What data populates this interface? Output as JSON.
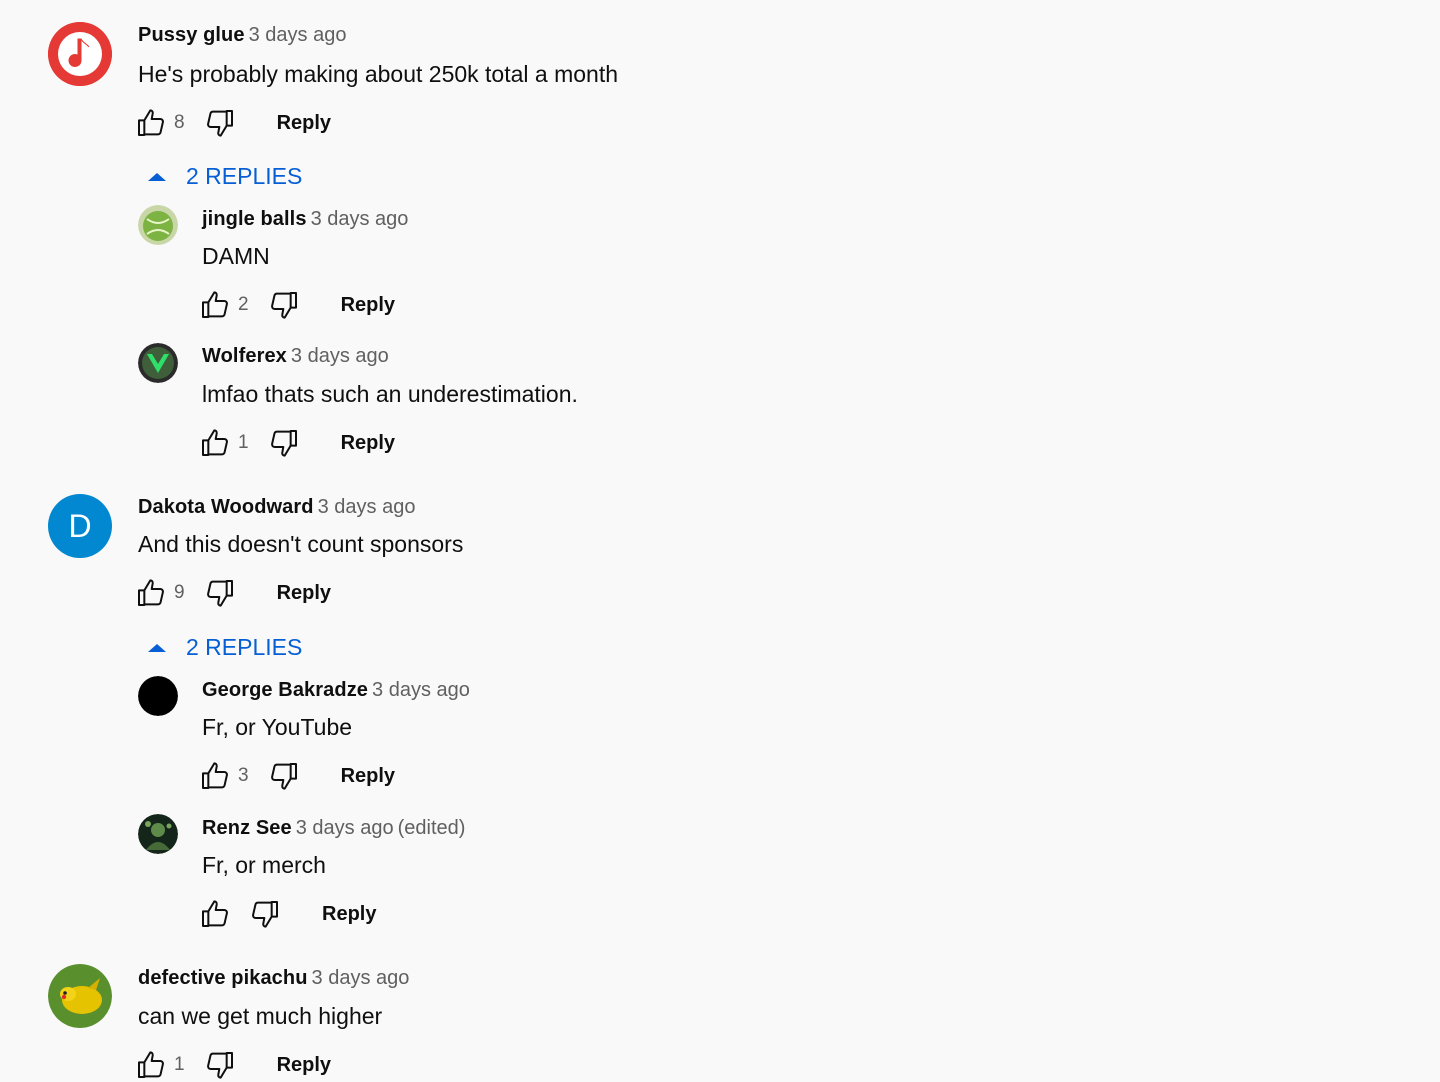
{
  "action_labels": {
    "reply": "Reply"
  },
  "comments": [
    {
      "author": "Pussy glue",
      "time": "3 days ago",
      "text": "He's probably making about 250k total a month",
      "likes": "8",
      "avatar": {
        "icon": "music-note-icon",
        "color": "#e53935"
      },
      "replies_toggle": "2 REPLIES",
      "replies": [
        {
          "author": "jingle balls",
          "time": "3 days ago",
          "text": "DAMN",
          "likes": "2",
          "avatar": {
            "icon": "tennis-ball-avatar",
            "color": "#8bc34a"
          }
        },
        {
          "author": "Wolferex",
          "time": "3 days ago",
          "text": "lmfao thats such an underestimation.",
          "likes": "1",
          "avatar": {
            "icon": "wolf-logo-avatar",
            "color": "#2e4d2e"
          }
        }
      ]
    },
    {
      "author": "Dakota Woodward",
      "time": "3 days ago",
      "text": "And this doesn't count sponsors",
      "likes": "9",
      "avatar": {
        "initial": "D",
        "color": "#0288d1"
      },
      "replies_toggle": "2 REPLIES",
      "replies": [
        {
          "author": "George Bakradze",
          "time": "3 days ago",
          "text": "Fr, or YouTube",
          "likes": "3",
          "avatar": {
            "icon": "black-circle-avatar",
            "color": "#000000"
          }
        },
        {
          "author": "Renz See",
          "time": "3 days ago",
          "edited": "(edited)",
          "text": "Fr, or merch",
          "likes": "",
          "avatar": {
            "icon": "dark-green-avatar",
            "color": "#1b3a1b"
          }
        }
      ]
    },
    {
      "author": "defective pikachu",
      "time": "3 days ago",
      "text": "can we get much higher",
      "likes": "1",
      "avatar": {
        "icon": "pikachu-avatar",
        "color": "#4caf50"
      }
    }
  ],
  "colors": {
    "link_blue": "#065fd4",
    "secondary_text": "#606060",
    "background": "#f9f9f9"
  }
}
